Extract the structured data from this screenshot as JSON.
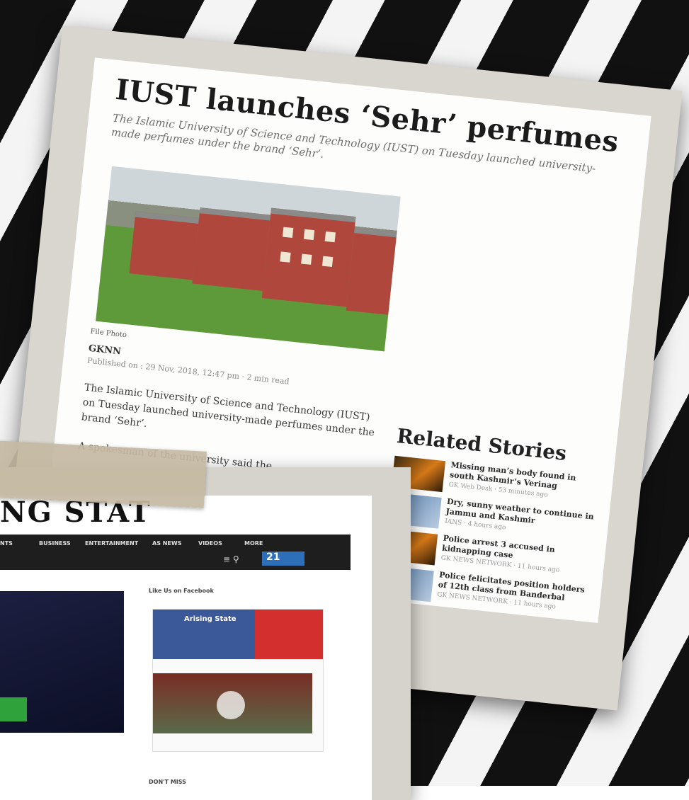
{
  "article": {
    "headline": "IUST launches ‘Sehr’ perfumes",
    "subhead": "The Islamic University of Science and Technology (IUST) on Tuesday launched university-made perfumes under the brand ‘Sehr’.",
    "caption": "File Photo",
    "author": "GKNN",
    "published": "Published on : 29 Nov, 2018, 12:47 pm · 2 min read",
    "body_para1": "The Islamic University of Science and Technology (IUST) on Tuesday launched university-made perfumes under the brand ‘Sehr’.",
    "body_para2_start": "A spokesman of the university said the"
  },
  "related": {
    "heading": "Related Stories",
    "stories": [
      {
        "title": "Missing man’s body found in south Kashmir’s Verinag",
        "meta": "GK Web Desk · 53 minutes ago"
      },
      {
        "title": "Dry, sunny weather to continue in Jammu and Kashmir",
        "meta": "IANS · 4 hours ago"
      },
      {
        "title": "Police arrest 3 accused in kidnapping case",
        "meta": "GK NEWS NETWORK · 11 hours ago"
      },
      {
        "title": "Police felicitates position holders of 12th class from Banderbal",
        "meta": "GK NEWS NETWORK · 11 hours ago"
      }
    ]
  },
  "site": {
    "masthead": "NG STAT",
    "nav": [
      "NTS",
      "BUSINESS",
      "ENTERTAINMENT",
      "AS NEWS",
      "VIDEOS",
      "MORE"
    ],
    "badge": "21",
    "fb_heading": "Like Us on Facebook",
    "fb_page": "Arising State",
    "dont_miss": "DON'T MISS"
  }
}
